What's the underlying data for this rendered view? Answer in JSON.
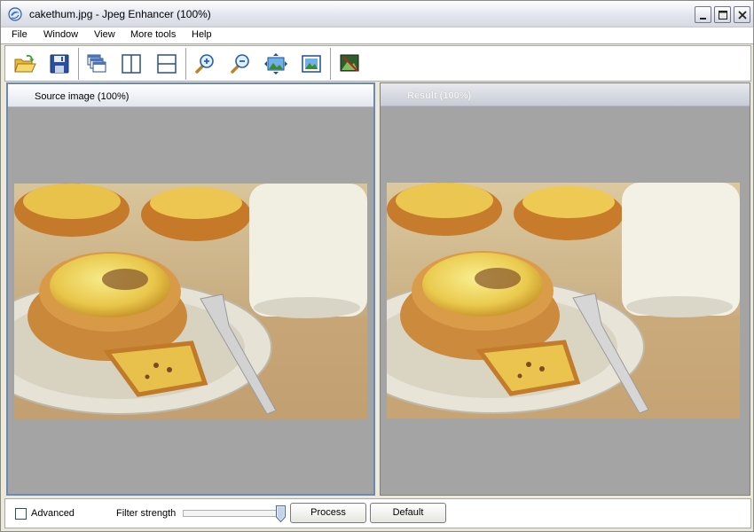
{
  "window": {
    "title": "cakethum.jpg - Jpeg Enhancer (100%)",
    "icon": "app-swirl-icon",
    "controls": [
      "minimize-icon",
      "maximize-icon",
      "close-icon"
    ]
  },
  "menu": {
    "items": [
      {
        "label": "File"
      },
      {
        "label": "Window"
      },
      {
        "label": "View"
      },
      {
        "label": "More tools"
      },
      {
        "label": "Help"
      }
    ]
  },
  "toolbar": {
    "buttons": [
      {
        "icon": "open-folder-icon"
      },
      {
        "icon": "save-disk-icon"
      },
      {
        "icon": "cascade-windows-icon"
      },
      {
        "icon": "split-vertical-icon"
      },
      {
        "icon": "split-horizontal-icon"
      },
      {
        "icon": "zoom-in-icon"
      },
      {
        "icon": "zoom-out-icon"
      },
      {
        "icon": "fit-to-window-icon"
      },
      {
        "icon": "actual-size-icon"
      },
      {
        "icon": "enhance-image-icon"
      }
    ]
  },
  "panels": {
    "source": {
      "title": "Source image (100%)",
      "image": "cake-tarts-photo"
    },
    "result": {
      "title": "Result (100%)",
      "image": "cake-tarts-photo-enhanced"
    }
  },
  "bottom": {
    "advanced_label": "Advanced",
    "advanced_checked": false,
    "filter_label": "Filter strength",
    "filter_value": 1.0,
    "process_label": "Process",
    "default_label": "Default"
  },
  "colors": {
    "active_panel_border": "#6b89b8",
    "panel_background": "#a4a4a4"
  }
}
